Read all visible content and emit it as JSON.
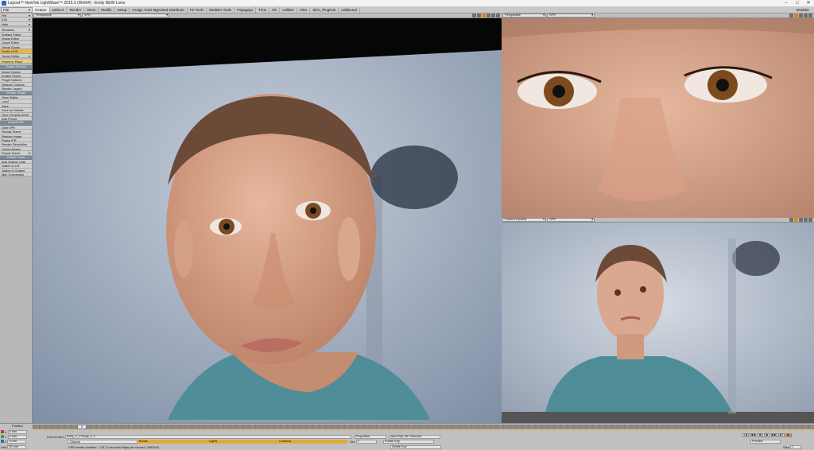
{
  "window": {
    "title": "Layout™ NewTek LightWave™ 2015.3 (Win64) - Emily NEW Lives",
    "controls": [
      "–",
      "□",
      "✕"
    ]
  },
  "tabs": {
    "menu_drop": "File",
    "items": [
      "Octane",
      "LWSLX",
      "Render",
      "Items",
      "Modify",
      "Setup",
      "Assign Tools Mgrs/and Distribute",
      "FX Tools",
      "Modeler Tools",
      "Papagayo",
      "Time",
      "I/O",
      "Utilities",
      "View",
      "Ski's_PlugPak",
      "Additional"
    ],
    "active": 0,
    "right_label": "Modeler"
  },
  "sidebar": {
    "items": [
      {
        "type": "item",
        "label": "File",
        "drop": true
      },
      {
        "type": "item",
        "label": "Edit",
        "drop": true
      },
      {
        "type": "item",
        "label": "Help",
        "drop": true
      },
      {
        "type": "gap"
      },
      {
        "type": "item",
        "label": "Windows",
        "drop": true
      },
      {
        "type": "item",
        "label": "Surface Editor"
      },
      {
        "type": "item",
        "label": "Image Editor"
      },
      {
        "type": "item",
        "label": "Graph Editor"
      },
      {
        "type": "item",
        "label": "Virtual Studio"
      },
      {
        "type": "item",
        "label": "Studio LIVE",
        "hl": true
      },
      {
        "type": "item",
        "label": "Scene Editor",
        "drop": true
      },
      {
        "type": "gap"
      },
      {
        "type": "item",
        "label": "Parent in Place",
        "hl2": true
      },
      {
        "type": "gap"
      },
      {
        "type": "head",
        "label": "Octane Render"
      },
      {
        "type": "item",
        "label": "About Octane"
      },
      {
        "type": "item",
        "label": "Enable Plugin"
      },
      {
        "type": "item",
        "label": "Plugin Options"
      },
      {
        "type": "item",
        "label": "Network Options"
      },
      {
        "type": "item",
        "label": "Render Layers"
      },
      {
        "type": "head",
        "label": "Render Target"
      },
      {
        "type": "item",
        "label": "Open Editor"
      },
      {
        "type": "item",
        "label": "Load"
      },
      {
        "type": "item",
        "label": "Save"
      },
      {
        "type": "item",
        "label": "Save as Default"
      },
      {
        "type": "item",
        "label": "Open Presets Shelf"
      },
      {
        "type": "item",
        "label": "Add Preset"
      },
      {
        "type": "head",
        "label": "Octane IPR"
      },
      {
        "type": "item",
        "label": "Open IPR"
      },
      {
        "type": "item",
        "label": "Reload Scene"
      },
      {
        "type": "item",
        "label": "Redraw Image"
      },
      {
        "type": "item",
        "label": "Pause IPR"
      },
      {
        "type": "item",
        "label": "Render Resolution"
      },
      {
        "type": "item",
        "label": "Cloud Upload"
      },
      {
        "type": "item",
        "label": "Export Scene",
        "drop": true
      },
      {
        "type": "head",
        "label": "Octane Tools"
      },
      {
        "type": "item",
        "label": "Add Octane Light"
      },
      {
        "type": "item",
        "label": "Switch to LW"
      },
      {
        "type": "item",
        "label": "Switch to Octane"
      },
      {
        "type": "item",
        "label": "Mat. Conversion"
      }
    ]
  },
  "viewports": {
    "main": {
      "view": "Perspective",
      "mode": "VPR"
    },
    "top_right": {
      "view": "Perspective",
      "mode": "VPR"
    },
    "bottom_right": {
      "view": "Current Camera",
      "mode": "VPR"
    }
  },
  "bottom": {
    "position_label": "Position",
    "x_label": "X",
    "x_value": "0 mm",
    "y_label": "Y",
    "y_value": "0 mm",
    "z_label": "Z",
    "z_value": "0 mm",
    "grid_label": "Grid",
    "grid_value": "50 mm",
    "current_frame": "0",
    "current_item_label": "Current Item",
    "current_item_value": "Emily_2_1 Emily_2_1",
    "objects_tab": "Objects",
    "bones_tab": "Bones",
    "lights_tab": "Lights",
    "cameras_tab": "Cameras",
    "properties_btn": "Properties",
    "sel_label": "Sel:",
    "sel_value": "1",
    "auto_key_label": "Auto Key: All Channels",
    "create_key_btn": "Create Key",
    "delete_key_btn": "Delete Key",
    "status_text": "VPR render duration : 176.72 seconds  Rays per second: 2062000",
    "preview_drop": "Preview",
    "step_label": "Step",
    "step_value": "1",
    "transport": [
      "|◀",
      "◀◀",
      "◀|",
      "|▶",
      "▶▶",
      "▶|",
      "▶"
    ]
  },
  "colors": {
    "accent": "#e19a22",
    "panel": "#c0c0c0",
    "header": "#7f8a96"
  }
}
